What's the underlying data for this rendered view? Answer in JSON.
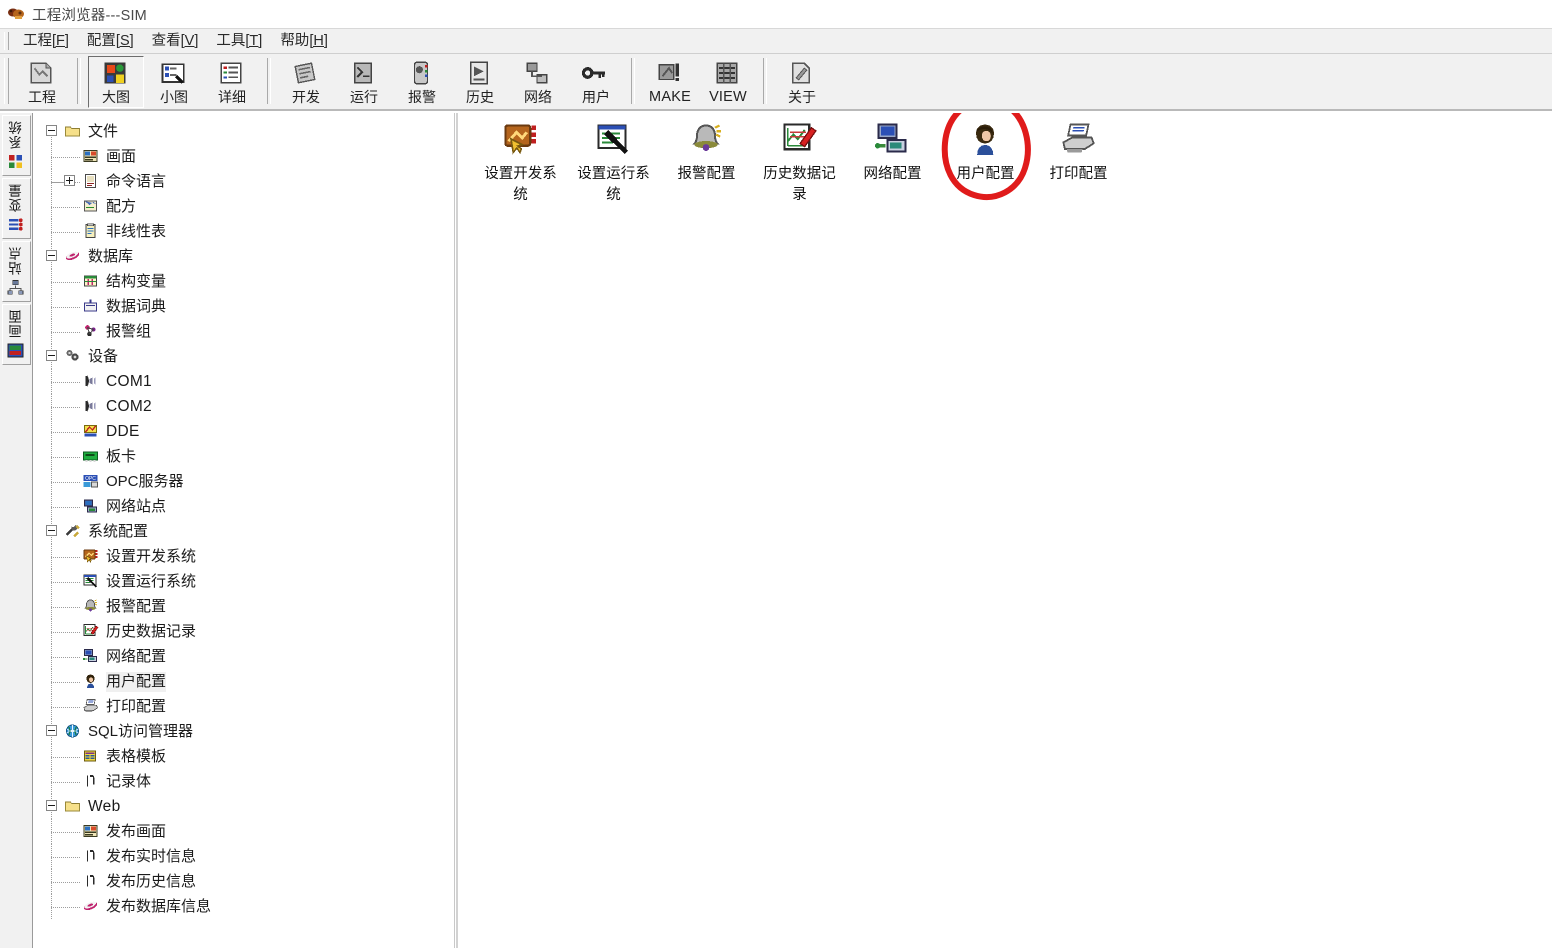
{
  "window": {
    "title": "工程浏览器---SIM",
    "app_icon": "project-browser-icon"
  },
  "menubar": {
    "items": [
      {
        "name": "menu-project",
        "text": "工程",
        "acc": "F"
      },
      {
        "name": "menu-config",
        "text": "配置",
        "acc": "S"
      },
      {
        "name": "menu-view",
        "text": "查看",
        "acc": "V"
      },
      {
        "name": "menu-tools",
        "text": "工具",
        "acc": "T"
      },
      {
        "name": "menu-help",
        "text": "帮助",
        "acc": "H"
      }
    ]
  },
  "toolbar": {
    "groups": [
      {
        "buttons": [
          {
            "name": "toolbar-project",
            "label": "工程",
            "icon": "project-icon",
            "active": false
          }
        ]
      },
      {
        "buttons": [
          {
            "name": "toolbar-large-icons",
            "label": "大图",
            "icon": "large-icons-icon",
            "active": true
          },
          {
            "name": "toolbar-small-icons",
            "label": "小图",
            "icon": "small-icons-icon",
            "active": false
          },
          {
            "name": "toolbar-details",
            "label": "详细",
            "icon": "details-icon",
            "active": false
          }
        ]
      },
      {
        "buttons": [
          {
            "name": "toolbar-develop",
            "label": "开发",
            "icon": "develop-icon",
            "active": false
          },
          {
            "name": "toolbar-runtime",
            "label": "运行",
            "icon": "runtime-icon",
            "active": false
          },
          {
            "name": "toolbar-alarm",
            "label": "报警",
            "icon": "alarm-icon",
            "active": false
          },
          {
            "name": "toolbar-history",
            "label": "历史",
            "icon": "history-icon",
            "active": false
          },
          {
            "name": "toolbar-network",
            "label": "网络",
            "icon": "network-icon",
            "active": false
          },
          {
            "name": "toolbar-user",
            "label": "用户",
            "icon": "key-icon",
            "active": false
          }
        ]
      },
      {
        "buttons": [
          {
            "name": "toolbar-make",
            "label": "MAKE",
            "icon": "make-icon",
            "active": false,
            "latin": true
          },
          {
            "name": "toolbar-view",
            "label": "VIEW",
            "icon": "view-icon",
            "active": false,
            "latin": true
          }
        ]
      },
      {
        "buttons": [
          {
            "name": "toolbar-about",
            "label": "关于",
            "icon": "about-icon",
            "active": false
          }
        ]
      }
    ]
  },
  "vtabs": {
    "items": [
      {
        "name": "vtab-system",
        "label": "系统",
        "icon": "system-tab-icon"
      },
      {
        "name": "vtab-variable",
        "label": "变量",
        "icon": "variable-tab-icon"
      },
      {
        "name": "vtab-site",
        "label": "站点",
        "icon": "site-tab-icon"
      },
      {
        "name": "vtab-screen",
        "label": "画面",
        "icon": "screen-tab-icon"
      }
    ]
  },
  "tree": {
    "nodes": [
      {
        "name": "tree-files",
        "label": "文件",
        "depth": 0,
        "expander": "minus",
        "icon": "folder-icon",
        "selected": false
      },
      {
        "name": "tree-screen",
        "label": "画面",
        "depth": 1,
        "expander": "none",
        "icon": "screen-icon",
        "selected": false
      },
      {
        "name": "tree-command-language",
        "label": "命令语言",
        "depth": 1,
        "expander": "plus",
        "icon": "script-icon",
        "selected": false
      },
      {
        "name": "tree-recipe",
        "label": "配方",
        "depth": 1,
        "expander": "none",
        "icon": "recipe-icon",
        "selected": false
      },
      {
        "name": "tree-nonlinear-table",
        "label": "非线性表",
        "depth": 1,
        "expander": "none",
        "icon": "table-icon",
        "selected": false
      },
      {
        "name": "tree-database",
        "label": "数据库",
        "depth": 0,
        "expander": "minus",
        "icon": "database-icon",
        "selected": false
      },
      {
        "name": "tree-struct-variable",
        "label": "结构变量",
        "depth": 1,
        "expander": "none",
        "icon": "struct-icon",
        "selected": false
      },
      {
        "name": "tree-data-dictionary",
        "label": "数据词典",
        "depth": 1,
        "expander": "none",
        "icon": "dictionary-icon",
        "selected": false
      },
      {
        "name": "tree-alarm-group",
        "label": "报警组",
        "depth": 1,
        "expander": "none",
        "icon": "alarm-group-icon",
        "selected": false
      },
      {
        "name": "tree-devices",
        "label": "设备",
        "depth": 0,
        "expander": "minus",
        "icon": "devices-icon",
        "selected": false
      },
      {
        "name": "tree-com1",
        "label": "COM1",
        "depth": 1,
        "expander": "none",
        "icon": "serial-port-icon",
        "selected": false,
        "latin": true
      },
      {
        "name": "tree-com2",
        "label": "COM2",
        "depth": 1,
        "expander": "none",
        "icon": "serial-port-icon",
        "selected": false,
        "latin": true
      },
      {
        "name": "tree-dde",
        "label": "DDE",
        "depth": 1,
        "expander": "none",
        "icon": "dde-icon",
        "selected": false,
        "latin": true
      },
      {
        "name": "tree-board-card",
        "label": "板卡",
        "depth": 1,
        "expander": "none",
        "icon": "board-card-icon",
        "selected": false
      },
      {
        "name": "tree-opc-server",
        "label": "OPC服务器",
        "depth": 1,
        "expander": "none",
        "icon": "opc-icon",
        "selected": false
      },
      {
        "name": "tree-network-station",
        "label": "网络站点",
        "depth": 1,
        "expander": "none",
        "icon": "net-station-icon",
        "selected": false
      },
      {
        "name": "tree-system-config",
        "label": "系统配置",
        "depth": 0,
        "expander": "minus",
        "icon": "wrench-icon",
        "selected": false
      },
      {
        "name": "tree-set-develop",
        "label": "设置开发系统",
        "depth": 1,
        "expander": "none",
        "icon": "set-develop-icon",
        "selected": false
      },
      {
        "name": "tree-set-runtime",
        "label": "设置运行系统",
        "depth": 1,
        "expander": "none",
        "icon": "set-runtime-icon",
        "selected": false
      },
      {
        "name": "tree-alarm-config",
        "label": "报警配置",
        "depth": 1,
        "expander": "none",
        "icon": "bell-icon",
        "selected": false
      },
      {
        "name": "tree-history-record",
        "label": "历史数据记录",
        "depth": 1,
        "expander": "none",
        "icon": "history-rec-icon",
        "selected": false
      },
      {
        "name": "tree-network-config",
        "label": "网络配置",
        "depth": 1,
        "expander": "none",
        "icon": "net-config-icon",
        "selected": false
      },
      {
        "name": "tree-user-config",
        "label": "用户配置",
        "depth": 1,
        "expander": "none",
        "icon": "user-icon",
        "selected": true
      },
      {
        "name": "tree-print-config",
        "label": "打印配置",
        "depth": 1,
        "expander": "none",
        "icon": "printer-icon",
        "selected": false
      },
      {
        "name": "tree-sql-manager",
        "label": "SQL访问管理器",
        "depth": 0,
        "expander": "minus",
        "icon": "globe-icon",
        "selected": false
      },
      {
        "name": "tree-table-template",
        "label": "表格模板",
        "depth": 1,
        "expander": "none",
        "icon": "table-template-icon",
        "selected": false
      },
      {
        "name": "tree-record-body",
        "label": "记录体",
        "depth": 1,
        "expander": "none",
        "icon": "record-icon",
        "selected": false
      },
      {
        "name": "tree-web",
        "label": "Web",
        "depth": 0,
        "expander": "minus",
        "icon": "folder-icon",
        "selected": false,
        "latin": true
      },
      {
        "name": "tree-publish-screen",
        "label": "发布画面",
        "depth": 1,
        "expander": "none",
        "icon": "screen-icon",
        "selected": false
      },
      {
        "name": "tree-publish-realtime",
        "label": "发布实时信息",
        "depth": 1,
        "expander": "none",
        "icon": "record-icon",
        "selected": false
      },
      {
        "name": "tree-publish-history",
        "label": "发布历史信息",
        "depth": 1,
        "expander": "none",
        "icon": "record-icon",
        "selected": false
      },
      {
        "name": "tree-publish-database",
        "label": "发布数据库信息",
        "depth": 1,
        "expander": "none",
        "icon": "database-icon",
        "selected": false
      }
    ]
  },
  "main": {
    "view_mode": "large-icons",
    "items": [
      {
        "name": "item-set-develop-system",
        "label": "设置开发系统",
        "icon": "set-develop-icon",
        "annotated": false
      },
      {
        "name": "item-set-runtime-system",
        "label": "设置运行系统",
        "icon": "set-runtime-icon",
        "annotated": false
      },
      {
        "name": "item-alarm-config",
        "label": "报警配置",
        "icon": "bell-icon",
        "annotated": false
      },
      {
        "name": "item-history-record",
        "label": "历史数据记录",
        "icon": "history-rec-icon",
        "annotated": false
      },
      {
        "name": "item-network-config",
        "label": "网络配置",
        "icon": "net-config-icon",
        "annotated": false
      },
      {
        "name": "item-user-config",
        "label": "用户配置",
        "icon": "user-icon",
        "annotated": true
      },
      {
        "name": "item-print-config",
        "label": "打印配置",
        "icon": "printer-icon",
        "annotated": false
      }
    ]
  },
  "annotation": {
    "name": "red-circle-annotation",
    "shape": "hand-drawn-ellipse",
    "color": "#e01b1b",
    "targets": "item-user-config"
  },
  "colors": {
    "window_bg": "#ffffff",
    "chrome_bg": "#f1f1f1",
    "text": "#1b1b1b",
    "annotation_red": "#e01b1b",
    "tree_selected_bg": "#f0f0f0"
  }
}
